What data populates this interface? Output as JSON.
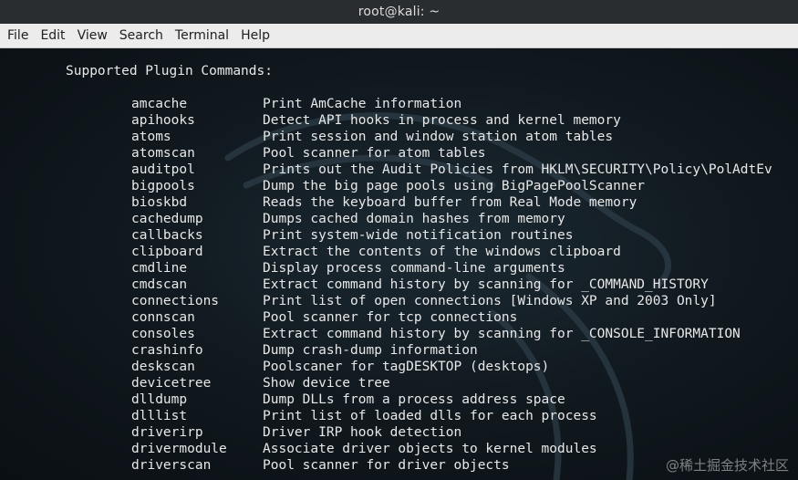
{
  "window": {
    "title": "root@kali: ~"
  },
  "menu": {
    "items": [
      "File",
      "Edit",
      "View",
      "Search",
      "Terminal",
      "Help"
    ]
  },
  "terminal": {
    "heading": "Supported Plugin Commands:",
    "commands": [
      {
        "name": "amcache",
        "desc": "Print AmCache information"
      },
      {
        "name": "apihooks",
        "desc": "Detect API hooks in process and kernel memory"
      },
      {
        "name": "atoms",
        "desc": "Print session and window station atom tables"
      },
      {
        "name": "atomscan",
        "desc": "Pool scanner for atom tables"
      },
      {
        "name": "auditpol",
        "desc": "Prints out the Audit Policies from HKLM\\SECURITY\\Policy\\PolAdtEv"
      },
      {
        "name": "bigpools",
        "desc": "Dump the big page pools using BigPagePoolScanner"
      },
      {
        "name": "bioskbd",
        "desc": "Reads the keyboard buffer from Real Mode memory"
      },
      {
        "name": "cachedump",
        "desc": "Dumps cached domain hashes from memory"
      },
      {
        "name": "callbacks",
        "desc": "Print system-wide notification routines"
      },
      {
        "name": "clipboard",
        "desc": "Extract the contents of the windows clipboard"
      },
      {
        "name": "cmdline",
        "desc": "Display process command-line arguments"
      },
      {
        "name": "cmdscan",
        "desc": "Extract command history by scanning for _COMMAND_HISTORY"
      },
      {
        "name": "connections",
        "desc": "Print list of open connections [Windows XP and 2003 Only]"
      },
      {
        "name": "connscan",
        "desc": "Pool scanner for tcp connections"
      },
      {
        "name": "consoles",
        "desc": "Extract command history by scanning for _CONSOLE_INFORMATION"
      },
      {
        "name": "crashinfo",
        "desc": "Dump crash-dump information"
      },
      {
        "name": "deskscan",
        "desc": "Poolscaner for tagDESKTOP (desktops)"
      },
      {
        "name": "devicetree",
        "desc": "Show device tree"
      },
      {
        "name": "dlldump",
        "desc": "Dump DLLs from a process address space"
      },
      {
        "name": "dlllist",
        "desc": "Print list of loaded dlls for each process"
      },
      {
        "name": "driverirp",
        "desc": "Driver IRP hook detection"
      },
      {
        "name": "drivermodule",
        "desc": "Associate driver objects to kernel modules"
      },
      {
        "name": "driverscan",
        "desc": "Pool scanner for driver objects"
      }
    ]
  },
  "watermark": "@稀土掘金技术社区",
  "colors": {
    "titlebar_bg": "#2a2d30",
    "menubar_bg": "#ececec",
    "terminal_bg": "#111a20",
    "terminal_fg": "#e8e8e8"
  }
}
